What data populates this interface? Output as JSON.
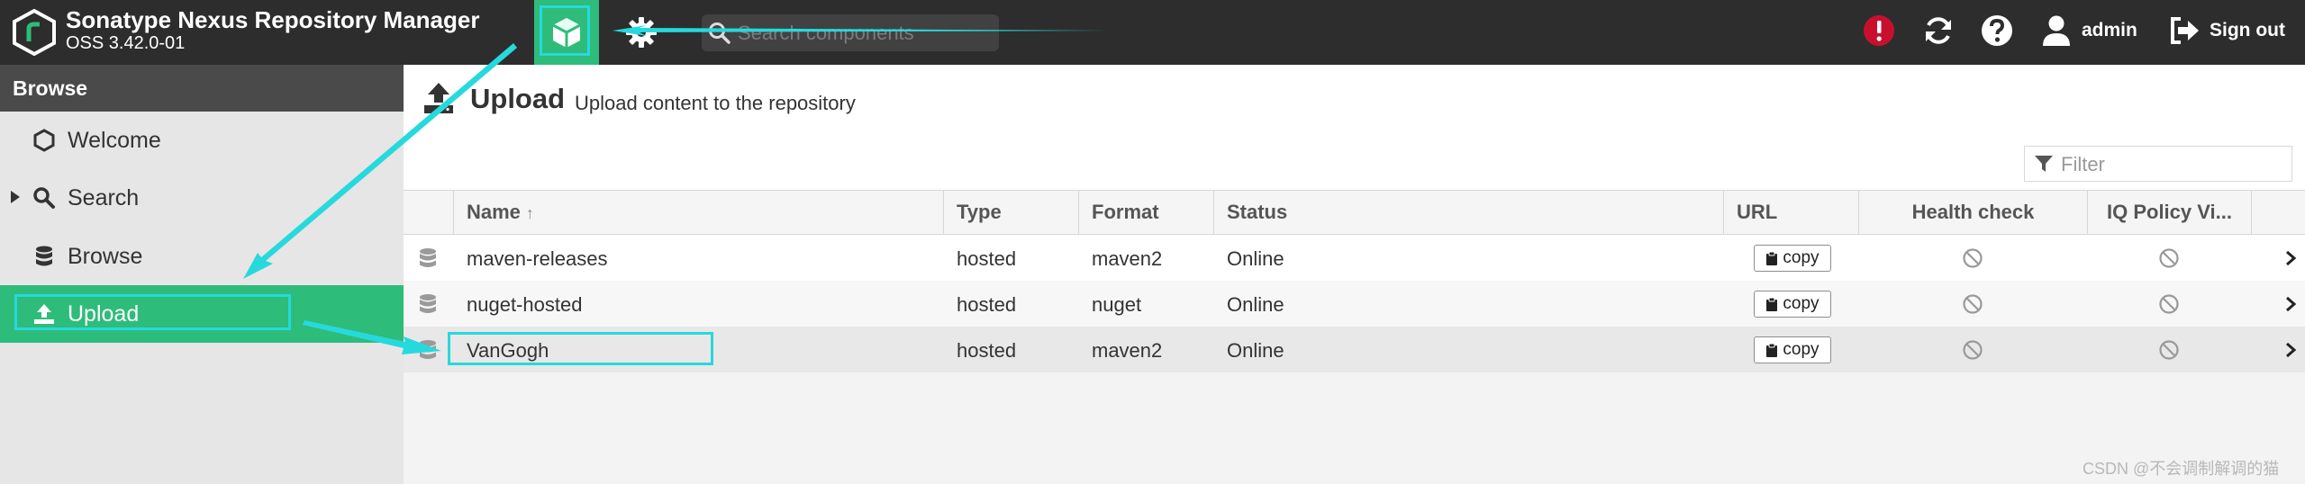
{
  "header": {
    "title": "Sonatype Nexus Repository Manager",
    "version": "OSS 3.42.0-01",
    "search_placeholder": "Search components",
    "user_label": "admin",
    "signout_label": "Sign out"
  },
  "sidebar": {
    "header": "Browse",
    "items": [
      {
        "label": "Welcome",
        "icon": "hexagon-icon"
      },
      {
        "label": "Search",
        "icon": "search-icon"
      },
      {
        "label": "Browse",
        "icon": "database-icon"
      },
      {
        "label": "Upload",
        "icon": "upload-icon"
      }
    ]
  },
  "main": {
    "title": "Upload",
    "subtitle": "Upload content to the repository",
    "filter_placeholder": "Filter",
    "columns": [
      "Name",
      "Type",
      "Format",
      "Status",
      "URL",
      "Health check",
      "IQ Policy Vi..."
    ],
    "sort_indicator": "↑",
    "copy_label": "copy",
    "rows": [
      {
        "name": "maven-releases",
        "type": "hosted",
        "format": "maven2",
        "status": "Online"
      },
      {
        "name": "nuget-hosted",
        "type": "hosted",
        "format": "nuget",
        "status": "Online"
      },
      {
        "name": "VanGogh",
        "type": "hosted",
        "format": "maven2",
        "status": "Online"
      }
    ]
  },
  "watermark": "CSDN @不会调制解调的猫",
  "colors": {
    "accent_green": "#2ebc7a",
    "header_bg": "#2d2d2d",
    "annotation_cyan": "#26d9dd",
    "alert_red": "#c8102e"
  }
}
